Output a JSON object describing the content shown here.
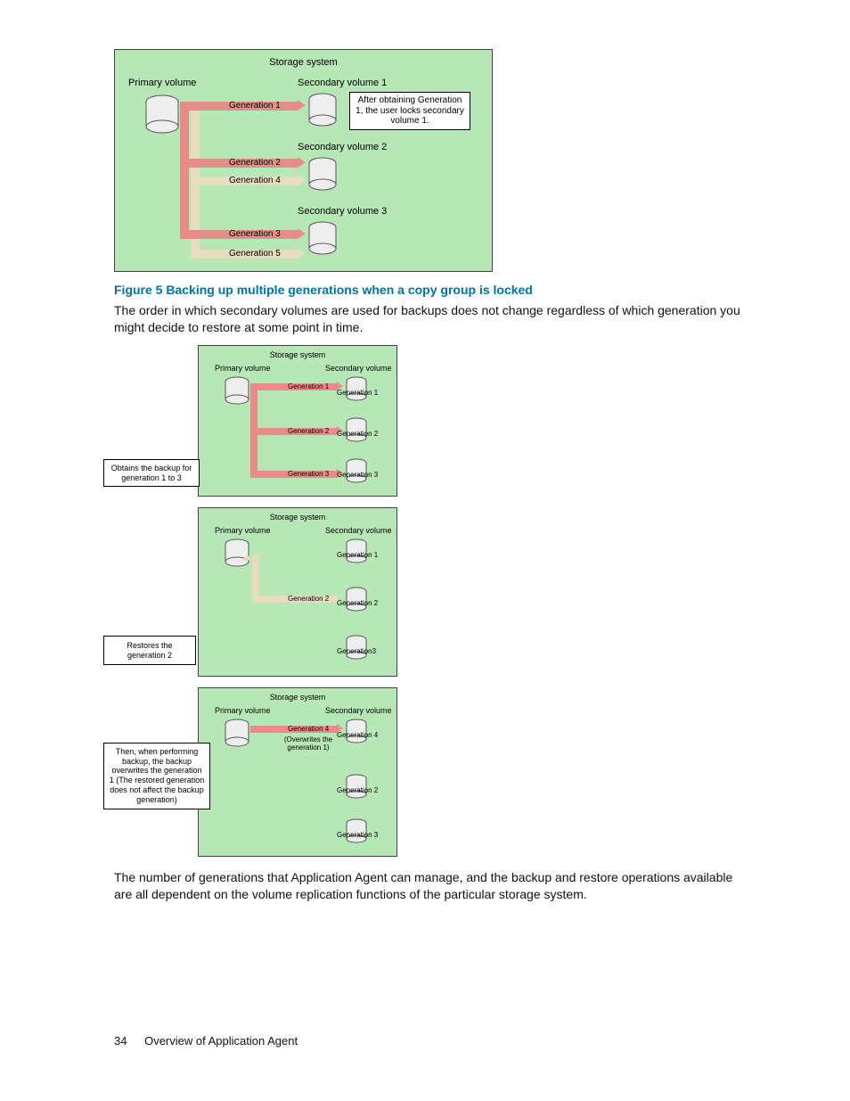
{
  "fig1": {
    "title": "Storage system",
    "primary": "Primary volume",
    "sec1": "Secondary volume 1",
    "sec2": "Secondary volume 2",
    "sec3": "Secondary volume 3",
    "g1": "Generation 1",
    "g2": "Generation 2",
    "g3": "Generation 3",
    "g4": "Generation 4",
    "g5": "Generation 5",
    "note": "After obtaining Generation 1, the user locks secondary volume 1."
  },
  "caption": "Figure 5 Backing up multiple generations when a copy group is locked",
  "para1": "The order in which secondary volumes are used for backups does not change regardless of which generation you might decide to restore at some point in time.",
  "panel1": {
    "title": "Storage system",
    "primary": "Primary volume",
    "secondary": "Secondary volume",
    "g1": "Generation 1",
    "rg1": "Generation 1",
    "g2": "Generation 2",
    "rg2": "Generation 2",
    "g3": "Generation 3",
    "rg3": "Generation 3",
    "side": "Obtains the backup for generation 1 to 3"
  },
  "panel2": {
    "title": "Storage system",
    "primary": "Primary volume",
    "secondary": "Secondary volume",
    "rg1": "Generation 1",
    "g2": "Generation 2",
    "rg2": "Generation 2",
    "rg3": "Generation3",
    "side": "Restores the generation 2"
  },
  "panel3": {
    "title": "Storage system",
    "primary": "Primary volume",
    "secondary": "Secondary volume",
    "g4": "Generation 4",
    "ow": "(Overwrites the generation 1)",
    "rg4": "Generation 4",
    "rg2": "Generation 2",
    "rg3": "Generation 3",
    "side": "Then, when performing backup, the backup overwrites the generation 1 (The restored generation does not affect the backup generation)"
  },
  "para2": "The number of generations that Application Agent can manage, and the backup and restore operations available are all dependent on the volume replication functions of the particular storage system.",
  "footer": {
    "num": "34",
    "title": "Overview of Application Agent"
  }
}
